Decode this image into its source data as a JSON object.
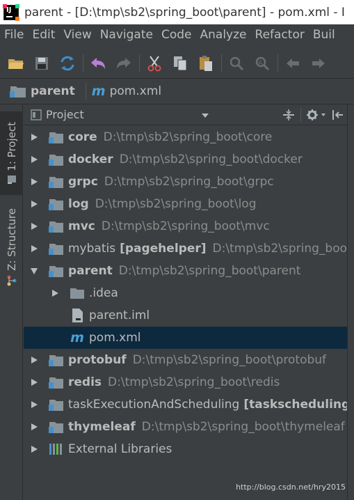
{
  "window": {
    "title": "parent - [D:\\tmp\\sb2\\spring_boot\\parent] - pom.xml - I",
    "app_icon": "intellij-idea-icon"
  },
  "menu": [
    "File",
    "Edit",
    "View",
    "Navigate",
    "Code",
    "Analyze",
    "Refactor",
    "Buil"
  ],
  "toolbar": {
    "buttons": [
      "open-folder-icon",
      "save-all-icon",
      "sync-icon",
      "undo-icon",
      "redo-icon",
      "cut-icon",
      "copy-icon",
      "paste-icon",
      "find-icon",
      "replace-icon",
      "back-icon",
      "forward-icon"
    ]
  },
  "breadcrumb": {
    "project": "parent",
    "file_prefix": "m",
    "file": "pom.xml"
  },
  "stripe": {
    "project_tab": "1: Project",
    "structure_tab": "Z: Structure"
  },
  "panel": {
    "view_label": "Project"
  },
  "tree": [
    {
      "name": "core",
      "path": "D:\\tmp\\sb2\\spring_boot\\core",
      "bold": true,
      "kind": "module",
      "arrow": "right"
    },
    {
      "name": "docker",
      "path": "D:\\tmp\\sb2\\spring_boot\\docker",
      "bold": true,
      "kind": "module",
      "arrow": "right"
    },
    {
      "name": "grpc",
      "path": "D:\\tmp\\sb2\\spring_boot\\grpc",
      "bold": true,
      "kind": "module",
      "arrow": "right"
    },
    {
      "name": "log",
      "path": "D:\\tmp\\sb2\\spring_boot\\log",
      "bold": true,
      "kind": "module",
      "arrow": "right"
    },
    {
      "name": "mvc",
      "path": "D:\\tmp\\sb2\\spring_boot\\mvc",
      "bold": true,
      "kind": "module",
      "arrow": "right"
    },
    {
      "name": "mybatis",
      "tag": "[pagehelper]",
      "path": "D:\\tmp\\sb2\\spring_boo",
      "bold": false,
      "kind": "module",
      "arrow": "right"
    },
    {
      "name": "parent",
      "path": "D:\\tmp\\sb2\\spring_boot\\parent",
      "bold": true,
      "kind": "module",
      "arrow": "down"
    },
    {
      "name": ".idea",
      "path": "",
      "bold": false,
      "kind": "folder",
      "arrow": "right"
    },
    {
      "name": "parent.iml",
      "path": "",
      "bold": false,
      "kind": "iml",
      "arrow": "none"
    },
    {
      "name": "pom.xml",
      "path": "",
      "bold": false,
      "kind": "maven",
      "arrow": "none"
    },
    {
      "name": "protobuf",
      "path": "D:\\tmp\\sb2\\spring_boot\\protobuf",
      "bold": true,
      "kind": "module",
      "arrow": "right"
    },
    {
      "name": "redis",
      "path": "D:\\tmp\\sb2\\spring_boot\\redis",
      "bold": true,
      "kind": "module",
      "arrow": "right"
    },
    {
      "name": "taskExecutionAndScheduling",
      "tag": "[taskscheduling]",
      "path": "",
      "bold": false,
      "kind": "module",
      "arrow": "right"
    },
    {
      "name": "thymeleaf",
      "path": "D:\\tmp\\sb2\\spring_boot\\thymeleaf",
      "bold": true,
      "kind": "module",
      "arrow": "right"
    },
    {
      "name": "External Libraries",
      "path": "",
      "bold": false,
      "kind": "libraries",
      "arrow": "right"
    }
  ],
  "selected_item": "pom.xml",
  "watermark": "http://blog.csdn.net/hry2015",
  "colors": {
    "background": "#3c3f41",
    "selection": "#0d293e",
    "text": "#bbbbbb",
    "path_text": "#8c8c8c",
    "folder": "#87939a",
    "maven_m": "#4b9fd5"
  }
}
